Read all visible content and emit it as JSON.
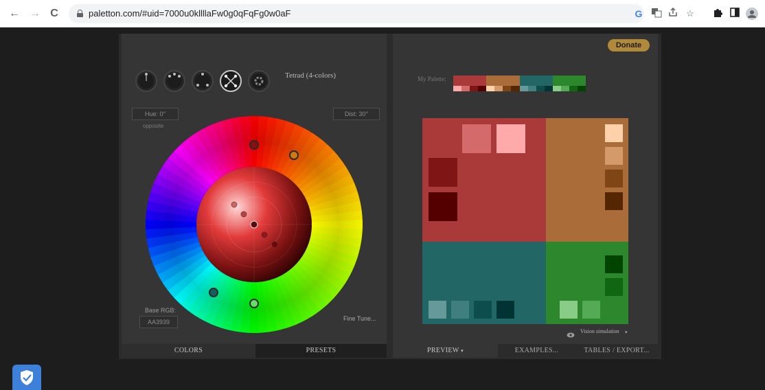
{
  "browser": {
    "url": "paletton.com/#uid=7000u0kllllaFw0g0qFqFg0w0aF",
    "nav": {
      "back": "←",
      "forward": "→",
      "reload": "C"
    },
    "extensions": [
      "google-icon",
      "translate-icon",
      "share-icon",
      "star-icon",
      "puzzle-icon",
      "sidepanel-icon",
      "profile-icon"
    ]
  },
  "header": {
    "donate_label": "Donate"
  },
  "scheme": {
    "buttons": [
      "mono",
      "adjacent",
      "triad",
      "tetrad",
      "free-style"
    ],
    "active": "tetrad",
    "title": "Tetrad (4-colors)"
  },
  "controls": {
    "hue_label": "Hue: 0°",
    "hue_sub": "opposite",
    "dist_label": "Dist: 30°",
    "base_rgb_label": "Base RGB:",
    "base_rgb_value": "AA3939",
    "fine_tune_label": "Fine Tune..."
  },
  "my_palette": {
    "label": "My Palette:",
    "groups": [
      {
        "main": "#aa3939",
        "shades": [
          "#ffaaaa",
          "#d46a6a",
          "#801515",
          "#550000"
        ]
      },
      {
        "main": "#aa6c39",
        "shades": [
          "#ffd1aa",
          "#d49a6a",
          "#804515",
          "#552700"
        ]
      },
      {
        "main": "#226666",
        "shades": [
          "#669999",
          "#407f7f",
          "#0d4d4d",
          "#003333"
        ]
      },
      {
        "main": "#2d882d",
        "shades": [
          "#88cc88",
          "#55aa55",
          "#116611",
          "#004400"
        ]
      }
    ]
  },
  "preview": {
    "quadrants": {
      "primary": {
        "main": "#aa3939",
        "shades": [
          "#d46a6a",
          "#ffaaaa",
          "#801515",
          "#550000"
        ]
      },
      "secondary1": {
        "main": "#aa6c39",
        "shades": [
          "#ffd1aa",
          "#d49a6a",
          "#804515",
          "#552700"
        ]
      },
      "secondary2": {
        "main": "#226666",
        "shades": [
          "#669999",
          "#407f7f",
          "#0d4d4d",
          "#003333"
        ]
      },
      "complement": {
        "main": "#2d882d",
        "shades": [
          "#004400",
          "#116611",
          "#88cc88",
          "#55aa55"
        ]
      }
    },
    "vision_label": "Vision simulation"
  },
  "bottom_tabs": {
    "left": [
      "COLORS",
      "PRESETS"
    ],
    "right": [
      "PREVIEW",
      "EXAMPLES...",
      "TABLES / EXPORT..."
    ]
  }
}
